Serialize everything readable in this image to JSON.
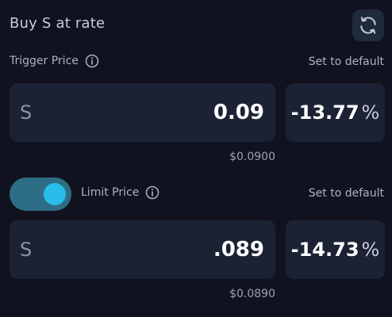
{
  "header": {
    "title": "Buy S at rate",
    "swap_icon": "refresh-icon"
  },
  "trigger": {
    "label": "Trigger Price",
    "info_icon": "info-icon",
    "default_link": "Set to default",
    "token": "S",
    "value": "0.09",
    "percent": "-13.77",
    "percent_sign": "%",
    "usd": "$0.0900"
  },
  "limit": {
    "toggle_on": true,
    "label": "Limit Price",
    "info_icon": "info-icon",
    "default_link": "Set to default",
    "token": "S",
    "value": ".089",
    "percent": "-14.73",
    "percent_sign": "%",
    "usd": "$0.0890"
  },
  "colors": {
    "background": "#11121f",
    "field": "#1b2234",
    "toggle_track": "#2d6e86",
    "toggle_knob": "#2bbde9",
    "swap_button": "#1f2a3d"
  }
}
